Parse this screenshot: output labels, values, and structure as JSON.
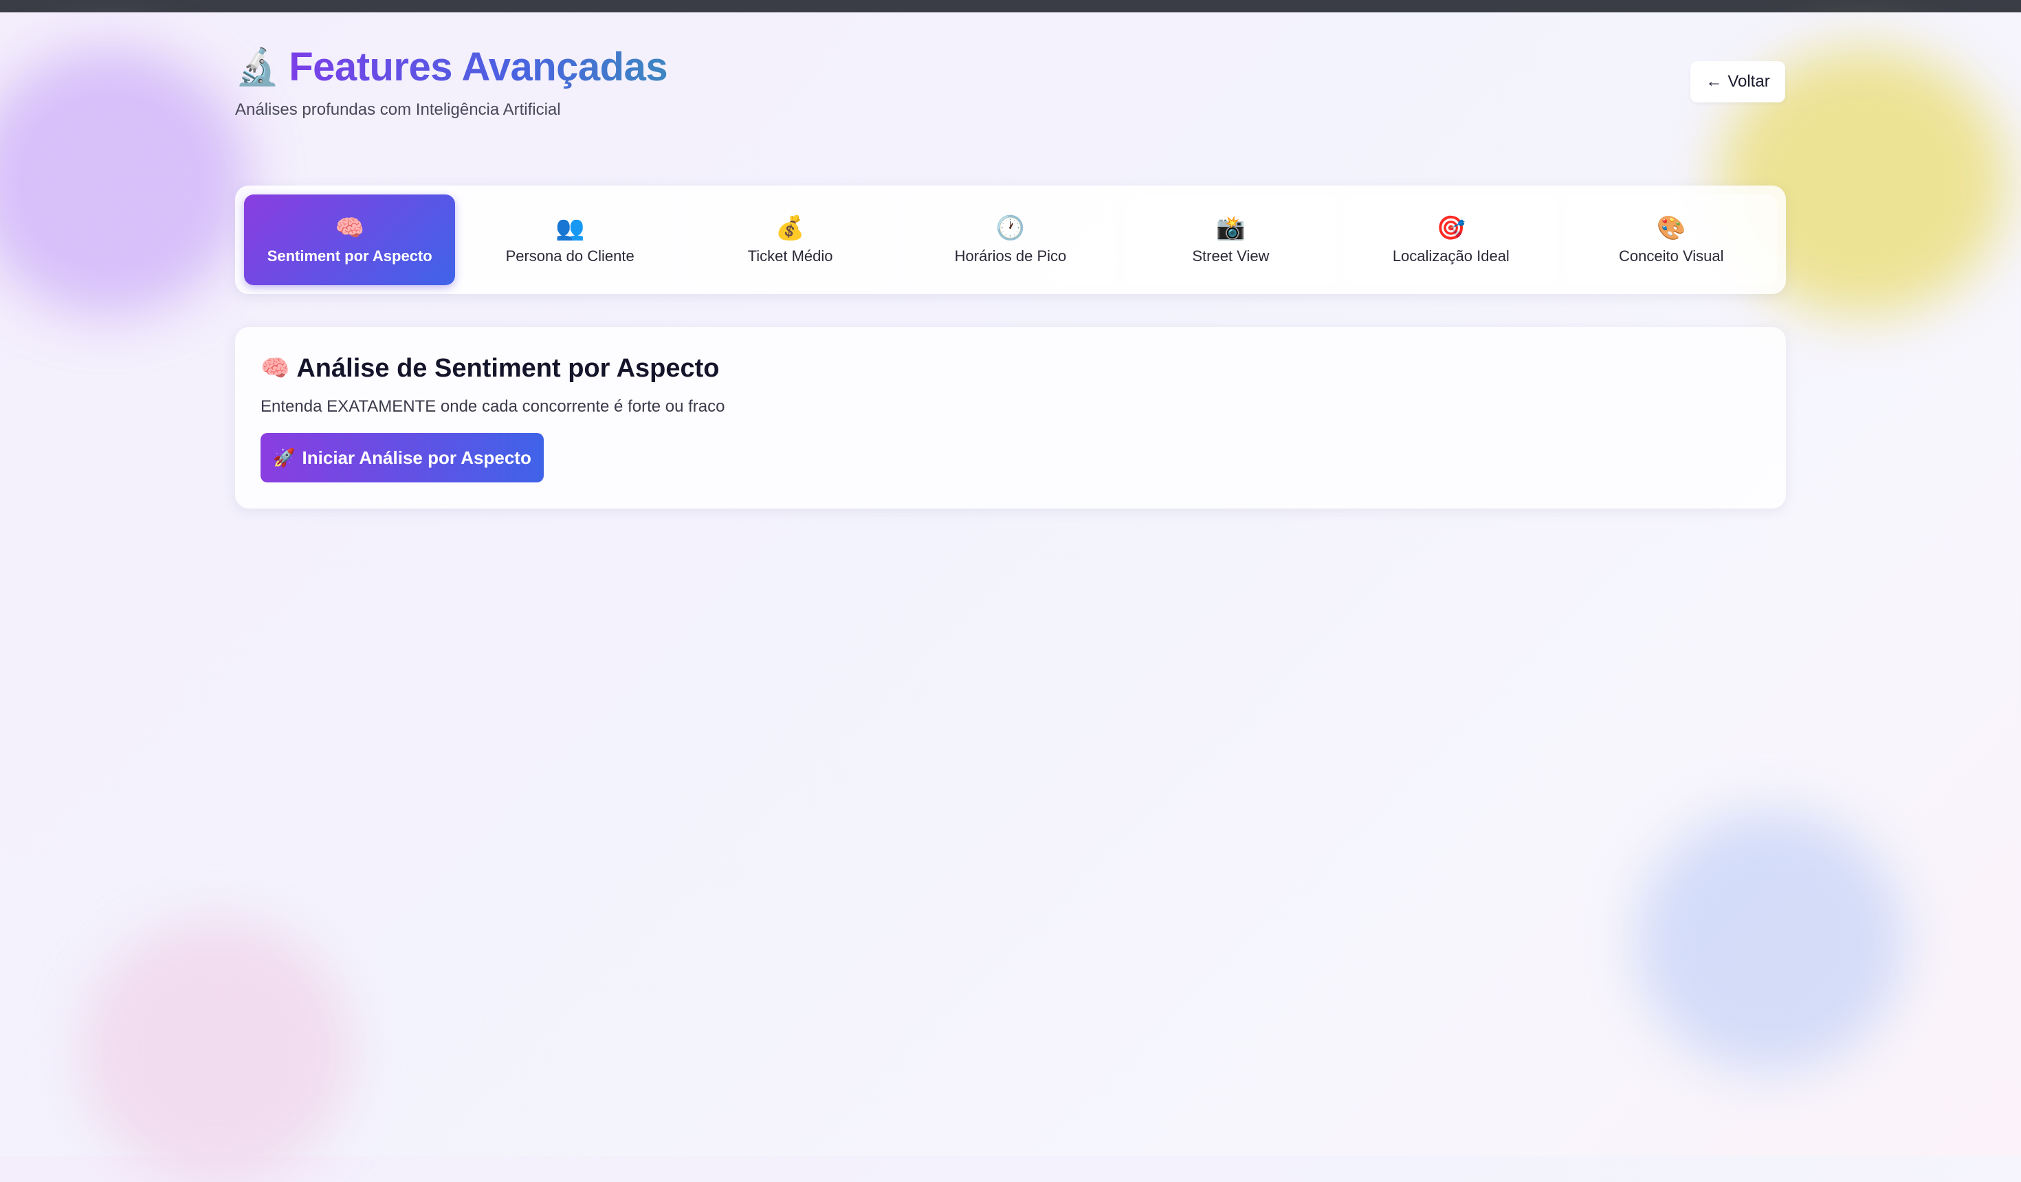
{
  "colors": {
    "accent_start": "#8a3de0",
    "accent_end": "#3f63e8",
    "title_gradient": [
      "#7b3fe8",
      "#4a63e0",
      "#3d86c0"
    ]
  },
  "header": {
    "icon": "🔬",
    "icon_name": "microscope-icon",
    "title": "Features Avançadas",
    "subtitle": "Análises profundas com Inteligência Artificial"
  },
  "back_button": {
    "icon": "←",
    "icon_name": "arrow-left-icon",
    "label": "Voltar"
  },
  "tabs": [
    {
      "icon": "🧠",
      "icon_name": "brain-icon",
      "label": "Sentiment por Aspecto",
      "active": true
    },
    {
      "icon": "👥",
      "icon_name": "people-icon",
      "label": "Persona do Cliente",
      "active": false
    },
    {
      "icon": "💰",
      "icon_name": "money-bag-icon",
      "label": "Ticket Médio",
      "active": false
    },
    {
      "icon": "🕐",
      "icon_name": "clock-icon",
      "label": "Horários de Pico",
      "active": false
    },
    {
      "icon": "📸",
      "icon_name": "camera-icon",
      "label": "Street View",
      "active": false
    },
    {
      "icon": "🎯",
      "icon_name": "target-icon",
      "label": "Localização Ideal",
      "active": false
    },
    {
      "icon": "🎨",
      "icon_name": "palette-icon",
      "label": "Conceito Visual",
      "active": false
    }
  ],
  "section": {
    "icon": "🧠",
    "icon_name": "brain-icon",
    "title": "Análise de Sentiment por Aspecto",
    "description": "Entenda EXATAMENTE onde cada concorrente é forte ou fraco",
    "button_icon": "🚀",
    "button_icon_name": "rocket-icon",
    "button_label": "Iniciar Análise por Aspecto"
  }
}
